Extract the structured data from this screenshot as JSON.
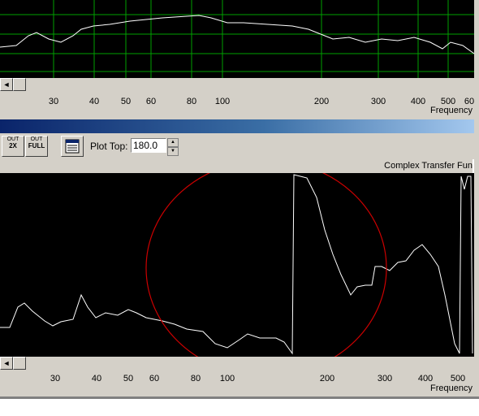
{
  "top_panel": {
    "ticks": [
      "30",
      "40",
      "50",
      "60",
      "80",
      "100",
      "200",
      "300",
      "400",
      "500",
      "60"
    ],
    "axis_title": "Frequency",
    "grid_color": "#00a000",
    "trace_color": "#ffffff"
  },
  "toolbar": {
    "zoom_out_2x": {
      "top": "OUT",
      "bottom": "2X"
    },
    "zoom_out_full": {
      "top": "OUT",
      "bottom": "FULL"
    },
    "plot_top_label": "Plot Top:",
    "plot_top_value": "180.0"
  },
  "bottom_panel": {
    "title": "Complex Transfer Fun",
    "ticks": [
      "30",
      "40",
      "50",
      "60",
      "80",
      "100",
      "200",
      "300",
      "400",
      "500"
    ],
    "axis_title": "Frequency",
    "annotation_color": "#cc0000"
  },
  "scroll": {
    "left_arrow": "◄"
  }
}
